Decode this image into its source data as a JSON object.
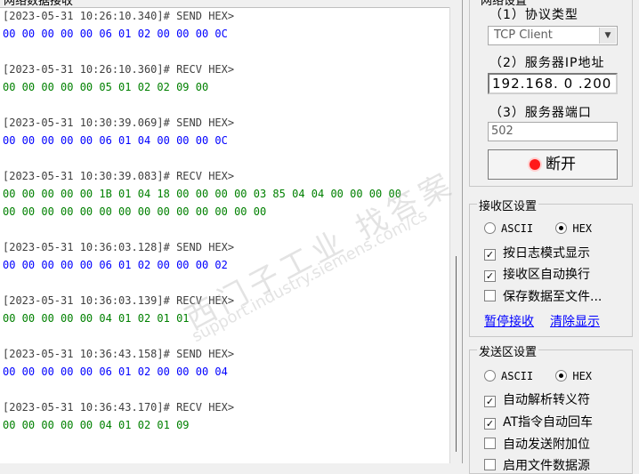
{
  "log": {
    "header": "网络数据接收",
    "entries": [
      {
        "ts": "[2023-05-31 10:26:10.340]# SEND HEX>",
        "type": "send",
        "lines": [
          "00 00 00 00 00 06 01 02 00 00 00 0C"
        ]
      },
      {
        "ts": "[2023-05-31 10:26:10.360]# RECV HEX>",
        "type": "recv",
        "lines": [
          "00 00 00 00 00 05 01 02 02 09 00"
        ]
      },
      {
        "ts": "[2023-05-31 10:30:39.069]# SEND HEX>",
        "type": "send",
        "lines": [
          "00 00 00 00 00 06 01 04 00 00 00 0C"
        ]
      },
      {
        "ts": "[2023-05-31 10:30:39.083]# RECV HEX>",
        "type": "recv",
        "lines": [
          "00 00 00 00 00 1B 01 04 18 00 00 00 00 03 85 04 04 00 00 00 00",
          "00 00 00 00 00 00 00 00 00 00 00 00 00 00"
        ]
      },
      {
        "ts": "[2023-05-31 10:36:03.128]# SEND HEX>",
        "type": "send",
        "lines": [
          "00 00 00 00 00 06 01 02 00 00 00 02"
        ]
      },
      {
        "ts": "[2023-05-31 10:36:03.139]# RECV HEX>",
        "type": "recv",
        "lines": [
          "00 00 00 00 00 04 01 02 01 01"
        ]
      },
      {
        "ts": "[2023-05-31 10:36:43.158]# SEND HEX>",
        "type": "send",
        "lines": [
          "00 00 00 00 00 06 01 02 00 00 00 04"
        ]
      },
      {
        "ts": "[2023-05-31 10:36:43.170]# RECV HEX>",
        "type": "recv",
        "lines": [
          "00 00 00 00 00 04 01 02 01 09"
        ]
      }
    ]
  },
  "watermark": {
    "text": "西门子工业 找答案",
    "url": "support.industry.siemens.com/cs"
  },
  "net_settings": {
    "title": "网络设置",
    "protocol_label": "（1）协议类型",
    "protocol_value": "TCP Client",
    "ip_label": "（2）服务器IP地址",
    "ip_value": "192.168. 0 .200",
    "port_label": "（3）服务器端口",
    "port_value": "502",
    "disconnect_label": "断开"
  },
  "recv_settings": {
    "title": "接收区设置",
    "radio_ascii": "ASCII",
    "radio_hex": "HEX",
    "selected": "HEX",
    "options": [
      {
        "label": "按日志模式显示",
        "checked": true
      },
      {
        "label": "接收区自动换行",
        "checked": true
      },
      {
        "label": "保存数据至文件...",
        "checked": false
      }
    ],
    "link_pause": "暂停接收",
    "link_clear": "清除显示"
  },
  "send_settings": {
    "title": "发送区设置",
    "radio_ascii": "ASCII",
    "radio_hex": "HEX",
    "selected": "HEX",
    "options": [
      {
        "label": "自动解析转义符",
        "checked": true
      },
      {
        "label": "AT指令自动回车",
        "checked": true
      },
      {
        "label": "自动发送附加位",
        "checked": false
      },
      {
        "label": "启用文件数据源",
        "checked": false
      }
    ]
  }
}
